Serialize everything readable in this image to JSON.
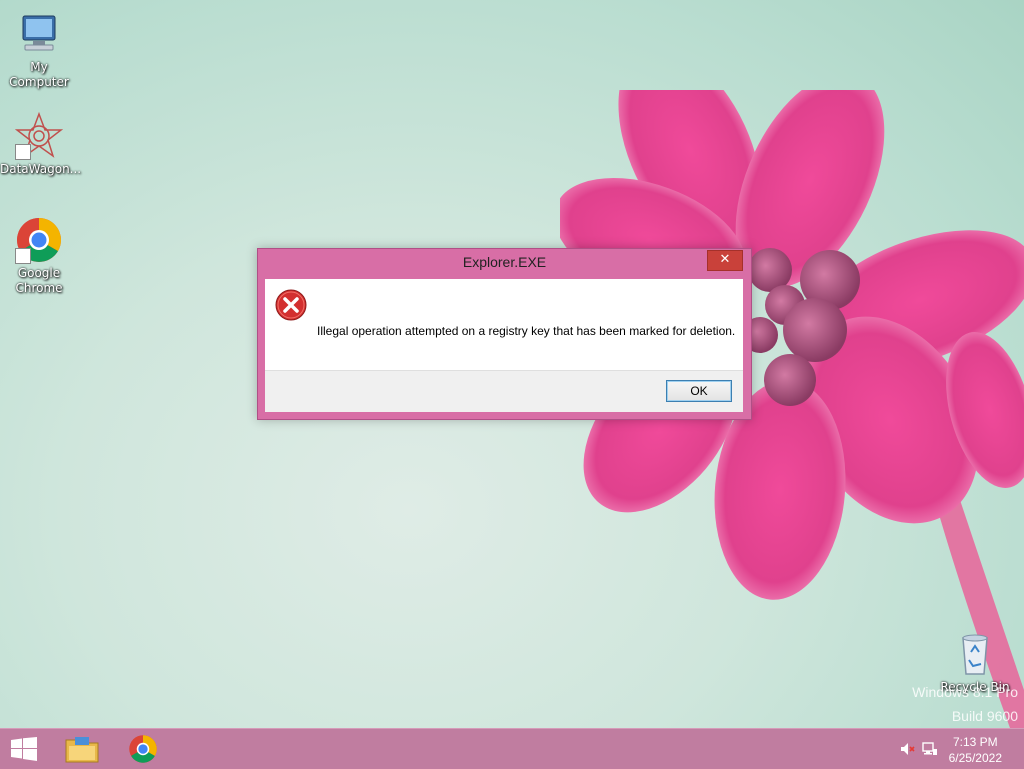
{
  "desktop": {
    "icons": [
      {
        "label": "My Computer",
        "icon": "computer-icon"
      },
      {
        "label": "DataWagon...",
        "icon": "datawagon-icon"
      },
      {
        "label": "Google\nChrome",
        "icon": "chrome-icon"
      },
      {
        "label": "Recycle Bin",
        "icon": "recycle-bin-icon"
      }
    ],
    "watermark": {
      "line1": "Windows 8.1 Pro",
      "line2": "Build 9600"
    }
  },
  "dialog": {
    "title": "Explorer.EXE",
    "close_symbol": "✕",
    "icon": "error-icon",
    "message": "Illegal operation attempted on a registry key that has been marked for deletion.",
    "ok_label": "OK"
  },
  "taskbar": {
    "start_icon": "windows-start-icon",
    "pinned": [
      {
        "name": "File Explorer",
        "icon": "file-explorer-icon"
      },
      {
        "name": "Google Chrome",
        "icon": "chrome-icon"
      }
    ],
    "tray": {
      "volume_icon": "volume-muted-icon",
      "network_icon": "network-icon",
      "time": "7:13 PM",
      "date": "6/25/2022"
    }
  },
  "colors": {
    "accent": "#d86ea6",
    "taskbar": "#c07da0",
    "close_button": "#c9413a",
    "error_red": "#d32f2f"
  }
}
